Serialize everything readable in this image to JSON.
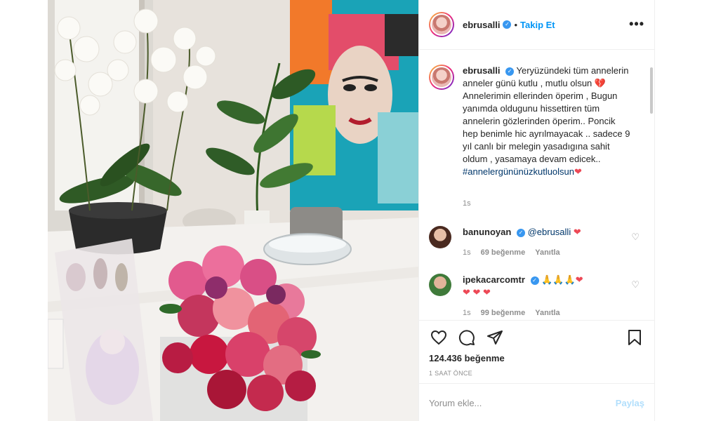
{
  "post": {
    "username": "ebrusalli",
    "follow_label": "Takip Et",
    "more_label": "•••",
    "caption": {
      "username": "ebrusalli",
      "text": "Yeryüzündeki tüm annelerin anneler günü kutlu , mutlu olsun",
      "text2": "Annelerimin ellerinden öperim , Bugun yanımda oldugunu hissettiren tüm annelerin gözlerinden öperim.. Poncik hep benimle hic ayrılmayacak .. sadece 9 yıl canlı bir melegin yasadıgına sahit oldum , yasamaya devam edicek..",
      "hashtag": "#annelergününüzkutluolsun",
      "time": "1s"
    },
    "comments": [
      {
        "username": "banunoyan",
        "mention": "@ebrusalli",
        "time": "1s",
        "likes": "69 beğenme",
        "reply": "Yanıtla"
      },
      {
        "username": "ipekacarcomtr",
        "time": "1s",
        "likes": "99 beğenme",
        "reply": "Yanıtla"
      }
    ],
    "likes_label": "124.436 beğenme",
    "time_ago": "1 SAAT ÖNCE",
    "comment_placeholder": "Yorum ekle...",
    "post_label": "Paylaş"
  },
  "icons": [
    "more-icon",
    "verified-icon",
    "heart-icon",
    "comment-icon",
    "share-icon",
    "bookmark-icon"
  ],
  "colors": {
    "accent": "#0095f6",
    "heart": "#ed4956",
    "muted": "#8e8e8e"
  }
}
